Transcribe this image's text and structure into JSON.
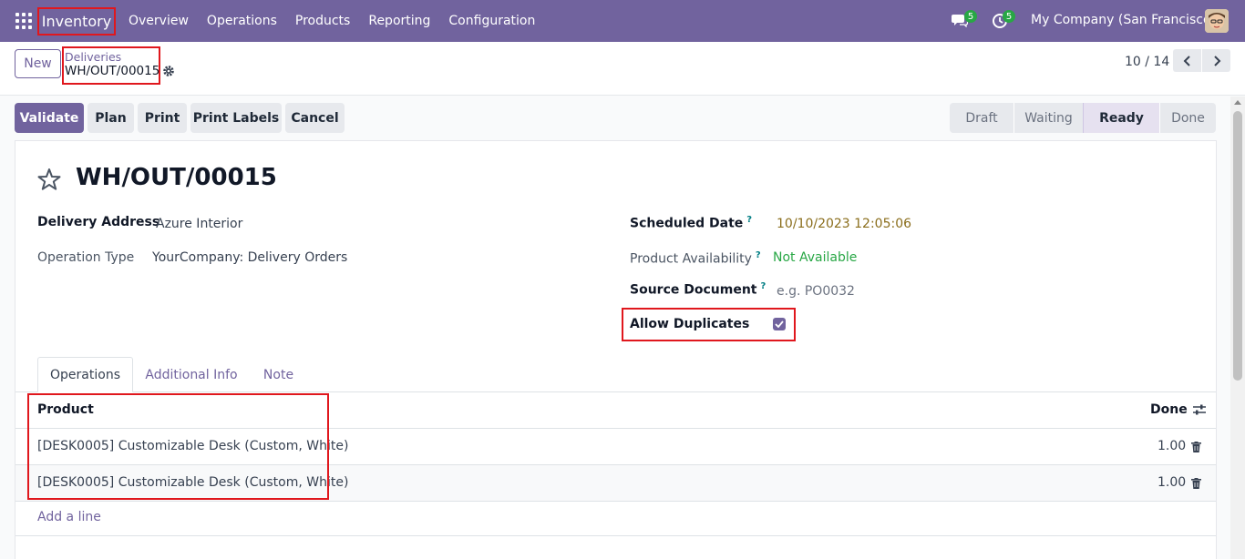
{
  "navbar": {
    "app_name": "Inventory",
    "menu": [
      "Overview",
      "Operations",
      "Products",
      "Reporting",
      "Configuration"
    ],
    "messages_count": "5",
    "activities_count": "5",
    "company": "My Company (San Francisco)"
  },
  "control_panel": {
    "new_label": "New",
    "breadcrumb_parent": "Deliveries",
    "breadcrumb_current": "WH/OUT/00015",
    "pager": "10 / 14"
  },
  "actions": {
    "validate": "Validate",
    "plan": "Plan",
    "print": "Print",
    "print_labels": "Print Labels",
    "cancel": "Cancel"
  },
  "status_bar": {
    "stages": [
      "Draft",
      "Waiting",
      "Ready",
      "Done"
    ],
    "current": "Ready"
  },
  "record": {
    "title": "WH/OUT/00015",
    "delivery_address_label": "Delivery Address",
    "delivery_address": "Azure Interior",
    "operation_type_label": "Operation Type",
    "operation_type": "YourCompany: Delivery Orders",
    "scheduled_date_label": "Scheduled Date",
    "scheduled_date": "10/10/2023 12:05:06",
    "availability_label": "Product Availability",
    "availability": "Not Available",
    "source_document_label": "Source Document",
    "source_document_placeholder": "e.g. PO0032",
    "allow_duplicates_label": "Allow Duplicates",
    "allow_duplicates": true,
    "help_mark": "?"
  },
  "tabs": [
    "Operations",
    "Additional Info",
    "Note"
  ],
  "table": {
    "col_product": "Product",
    "col_done": "Done",
    "rows": [
      {
        "product": "[DESK0005] Customizable Desk (Custom, White)",
        "done": "1.00"
      },
      {
        "product": "[DESK0005] Customizable Desk (Custom, White)",
        "done": "1.00"
      }
    ],
    "add_line": "Add a line"
  },
  "colors": {
    "brand": "#71639e",
    "highlight": "#e0171d",
    "success": "#28a745"
  }
}
